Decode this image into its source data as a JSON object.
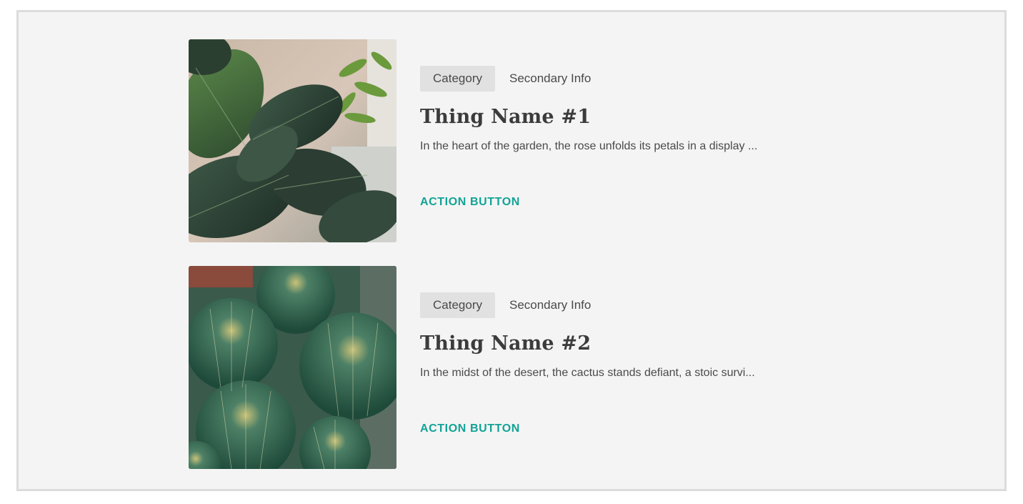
{
  "colors": {
    "background": "#f4f4f4",
    "frame_border": "#dcdcdc",
    "tag_background": "#e1e1e1",
    "accent": "#11a397",
    "text": "#4a4a4a",
    "title": "#3b3b3b"
  },
  "items": [
    {
      "image": "fiddle-leaf-fig-photo",
      "category": "Category",
      "secondary_info": "Secondary Info",
      "title": "Thing Name #1",
      "description": "In the heart of the garden, the rose unfolds its petals in a display ...",
      "action_label": "ACTION BUTTON"
    },
    {
      "image": "barrel-cactus-photo",
      "category": "Category",
      "secondary_info": "Secondary Info",
      "title": "Thing Name #2",
      "description": "In the midst of the desert, the cactus stands defiant, a stoic survi...",
      "action_label": "ACTION BUTTON"
    }
  ]
}
